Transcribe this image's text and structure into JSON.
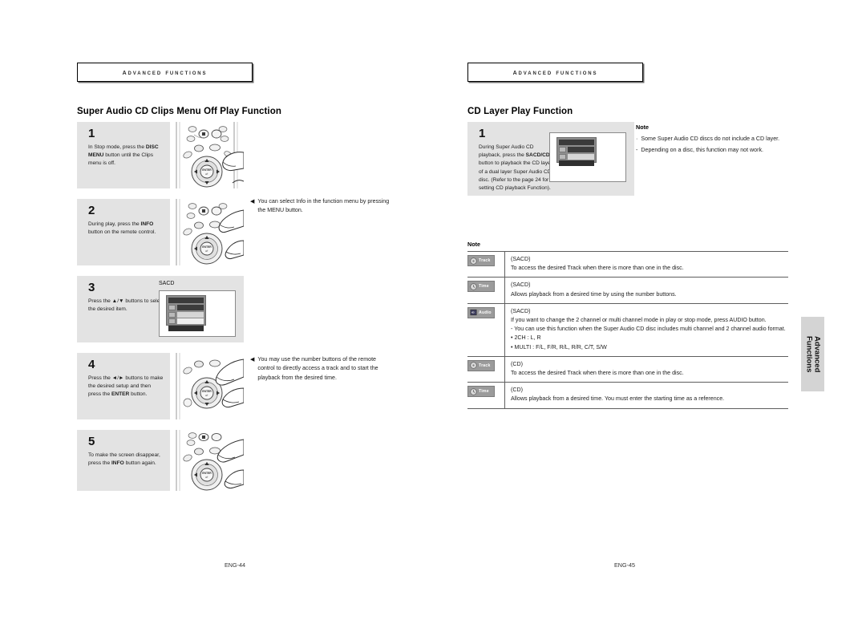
{
  "left_page": {
    "chapter_header": "Advanced Functions",
    "section_title": "Super Audio CD Clips Menu Off Play Function",
    "footer": "ENG-44",
    "steps": [
      {
        "number": "1",
        "text_html": "In Stop mode, press the <b>DISC MENU</b> button until the Clips menu is off.",
        "illustration": "remote-control"
      },
      {
        "number": "2",
        "text_html": "During play, press the <b>INFO</b> button on the remote control.",
        "illustration": "remote-control"
      },
      {
        "number": "3",
        "text_html": "Press the ▲/▼ buttons to select the desired item.",
        "illustration": "osd-screen",
        "osd_caption": "SACD"
      },
      {
        "number": "4",
        "text_html": "Press the ◄/► buttons to make the desired setup and then press the <b>ENTER</b> button.",
        "illustration": "remote-control"
      },
      {
        "number": "5",
        "text_html": "To make the screen disappear, press the <b>INFO</b> button again.",
        "illustration": "remote-control"
      }
    ],
    "side_notes": [
      {
        "bullet": "◀",
        "text": "You can select Info in the function menu by pressing the MENU button."
      },
      {
        "bullet": "◀",
        "text": "You may use the number buttons of the remote control to directly access a track and to start the playback from the desired time."
      }
    ]
  },
  "right_page": {
    "chapter_header": "Advanced Functions",
    "section_title": "CD Layer Play Function",
    "footer": "ENG-45",
    "step": {
      "number": "1",
      "text_html": "During Super Audio CD playback, press the <b>SACD/CD</b> button to playback the CD layer of a dual layer Super Audio CD disc. (Refer to the page 24 for setting CD playback Function)."
    },
    "note_block": {
      "heading": "Note",
      "items": [
        "Some Super Audio CD discs do not include a CD layer.",
        "Depending on a disc, this function may not work."
      ]
    },
    "note_table": {
      "heading": "Note",
      "rows": [
        {
          "icon": "track-icon",
          "icon_label": "Track",
          "kind": "(SACD)",
          "lines": [
            "To access the desired Track when there is more than one in the disc."
          ]
        },
        {
          "icon": "time-icon",
          "icon_label": "Time",
          "kind": "(SACD)",
          "lines": [
            "Allows playback from a desired time by using the number buttons."
          ]
        },
        {
          "icon": "audio-icon",
          "icon_label": "Audio",
          "kind": "(SACD)",
          "lines": [
            "If you want to change the 2 channel or multi channel mode in play or stop mode, press AUDIO button.",
            "- You can use this function when the Super Audio CD disc includes multi channel and 2 channel audio format.",
            "• 2CH : L, R",
            "• MULTI : F/L, F/R, R/L, R/R, C/T, S/W"
          ]
        },
        {
          "icon": "track-icon",
          "icon_label": "Track",
          "kind": "(CD)",
          "lines": [
            "To access the desired Track when there is more than one in the disc."
          ]
        },
        {
          "icon": "time-icon",
          "icon_label": "Time",
          "kind": "(CD)",
          "lines": [
            "Allows playback from a desired time. You must enter the starting time as a reference."
          ]
        }
      ]
    }
  },
  "side_tab": {
    "line1": "Advanced",
    "line2": "Functions"
  },
  "colors": {
    "step_background": "#e3e3e3",
    "side_tab_background": "#d4d4d4",
    "rule": "#5e5e5e"
  }
}
